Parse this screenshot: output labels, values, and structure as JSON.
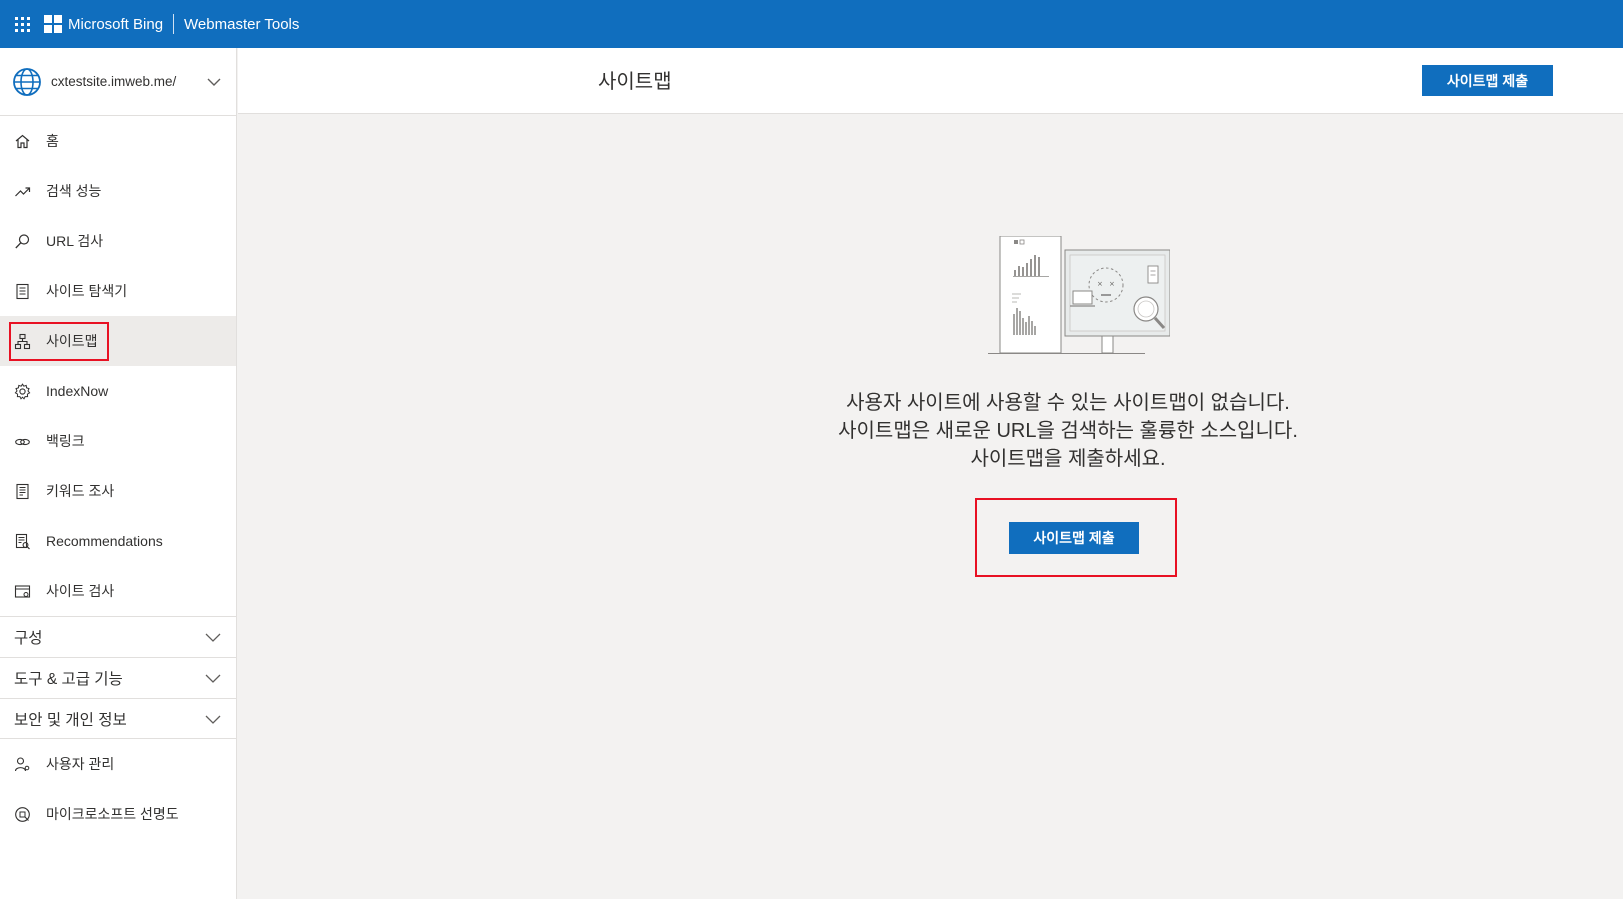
{
  "topbar": {
    "brand": "Microsoft Bing",
    "product": "Webmaster Tools",
    "color": "#106ebe"
  },
  "sidebar": {
    "site": "cxtestsite.imweb.me/",
    "items": [
      {
        "label": "홈",
        "icon": "home-icon"
      },
      {
        "label": "검색 성능",
        "icon": "trending-icon"
      },
      {
        "label": "URL 검사",
        "icon": "search-icon"
      },
      {
        "label": "사이트 탐색기",
        "icon": "document-list-icon"
      },
      {
        "label": "사이트맵",
        "icon": "sitemap-icon",
        "active": true
      },
      {
        "label": "IndexNow",
        "icon": "gear-icon"
      },
      {
        "label": "백링크",
        "icon": "link-icon"
      },
      {
        "label": "키워드 조사",
        "icon": "document-icon"
      },
      {
        "label": "Recommendations",
        "icon": "recommendations-icon"
      },
      {
        "label": "사이트 검사",
        "icon": "site-scan-icon"
      }
    ],
    "sections": [
      {
        "label": "구성"
      },
      {
        "label": "도구 & 고급 기능"
      },
      {
        "label": "보안 및 개인 정보"
      }
    ],
    "bottom_items": [
      {
        "label": "사용자 관리",
        "icon": "users-icon"
      },
      {
        "label": "마이크로소프트 선명도",
        "icon": "clarity-icon"
      }
    ]
  },
  "main": {
    "title": "사이트맵",
    "header_button": "사이트맵 제출",
    "empty_state": {
      "line1": "사용자 사이트에 사용할 수 있는 사이트맵이 없습니다.",
      "line2": "사이트맵은 새로운 URL을 검색하는 훌륭한 소스입니다.",
      "line3": "사이트맵을 제출하세요.",
      "button": "사이트맵 제출"
    }
  },
  "colors": {
    "accent": "#106ebe",
    "highlight": "#e81123"
  }
}
